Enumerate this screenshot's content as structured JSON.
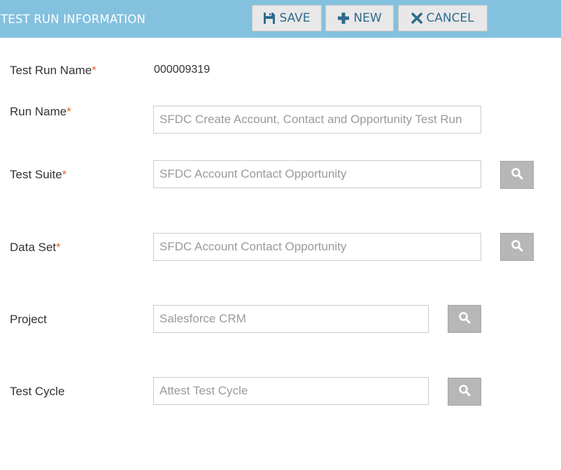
{
  "header": {
    "title": "TEST RUN INFORMATION",
    "save_label": "SAVE",
    "new_label": "NEW",
    "cancel_label": "CANCEL"
  },
  "form": {
    "test_run_name": {
      "label": "Test Run Name",
      "required": "*",
      "value": "000009319"
    },
    "run_name": {
      "label": "Run Name",
      "required": "*",
      "value": "SFDC Create Account, Contact and Opportunity Test Run"
    },
    "test_suite": {
      "label": "Test Suite",
      "required": "*",
      "value": "SFDC Account Contact Opportunity"
    },
    "data_set": {
      "label": "Data Set",
      "required": "*",
      "value": "SFDC Account Contact Opportunity"
    },
    "project": {
      "label": "Project",
      "value": "Salesforce CRM"
    },
    "test_cycle": {
      "label": "Test Cycle",
      "value": "Attest Test Cycle"
    }
  },
  "colors": {
    "header_bg": "#84c1df",
    "button_text": "#2e6b8d",
    "required_marker": "#e06a2f",
    "search_button_bg": "#b7b7b7"
  },
  "icons": [
    "save-icon",
    "plus-icon",
    "close-icon",
    "search-icon"
  ]
}
